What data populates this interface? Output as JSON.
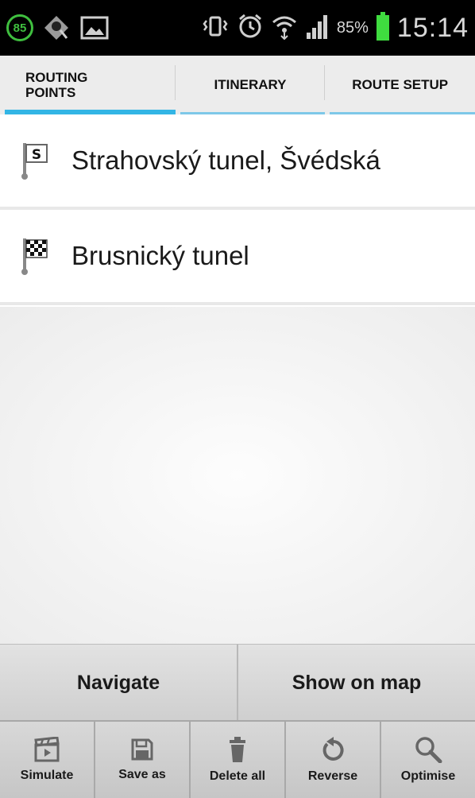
{
  "status_bar": {
    "notification_badge": "85",
    "battery_percent": "85%",
    "time": "15:14",
    "icons": [
      "notification-85-icon",
      "signal-location-icon",
      "image-icon",
      "vibrate-icon",
      "alarm-icon",
      "wifi-icon",
      "cell-signal-icon",
      "battery-icon"
    ],
    "battery_color": "#3fdc3f"
  },
  "tabs": [
    {
      "label": "Routing\nPoints",
      "active": true
    },
    {
      "label": "Itinerary",
      "active": false
    },
    {
      "label": "Route Setup",
      "active": false
    }
  ],
  "accent_color": "#33b5e5",
  "routing_points": [
    {
      "label": "Strahovský tunel, Švédská",
      "icon": "start-flag-icon"
    },
    {
      "label": "Brusnický tunel",
      "icon": "finish-flag-icon"
    }
  ],
  "actions": {
    "navigate_label": "Navigate",
    "show_on_map_label": "Show on map"
  },
  "toolbar": {
    "simulate_label": "Simulate",
    "save_as_label": "Save as",
    "delete_all_label": "Delete all",
    "reverse_label": "Reverse",
    "optimise_label": "Optimise"
  }
}
